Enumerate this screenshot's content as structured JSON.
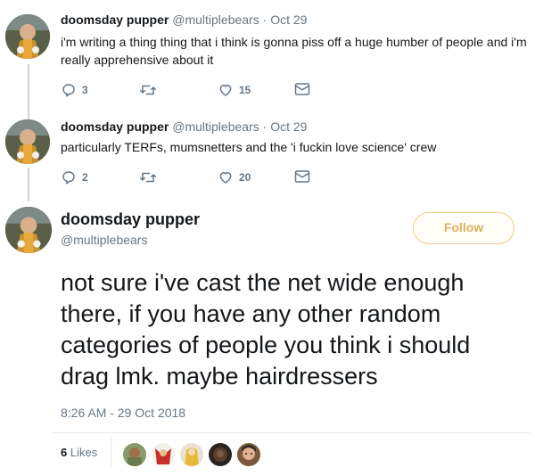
{
  "tweets": [
    {
      "name": "doomsday pupper",
      "handle": "@multiplebears",
      "separator": "·",
      "date": "Oct 29",
      "text": "i'm writing a thing thing that i think is gonna piss off a huge humber of people and i'm really apprehensive about it",
      "replies": "3",
      "retweets": "",
      "likes": "15"
    },
    {
      "name": "doomsday pupper",
      "handle": "@multiplebears",
      "separator": "·",
      "date": "Oct 29",
      "text": "particularly TERFs, mumsnetters and the 'i fuckin love science' crew",
      "replies": "2",
      "retweets": "",
      "likes": "20"
    }
  ],
  "main_tweet": {
    "name": "doomsday pupper",
    "handle": "@multiplebears",
    "follow_label": "Follow",
    "text": "not sure i've cast the net wide enough there, if you have any other random categories of people you think i should drag lmk. maybe hairdressers",
    "timestamp": "8:26 AM - 29 Oct 2018",
    "likes_count": "6",
    "likes_label": "Likes"
  },
  "icons": {
    "reply": "reply-icon",
    "retweet": "retweet-icon",
    "like": "heart-icon",
    "dm": "envelope-icon"
  },
  "colors": {
    "text": "#14171a",
    "secondary": "#657786",
    "follow_border": "#f0cc8a",
    "follow_text": "#e0b25f",
    "thread_line": "#ccd6dd"
  }
}
